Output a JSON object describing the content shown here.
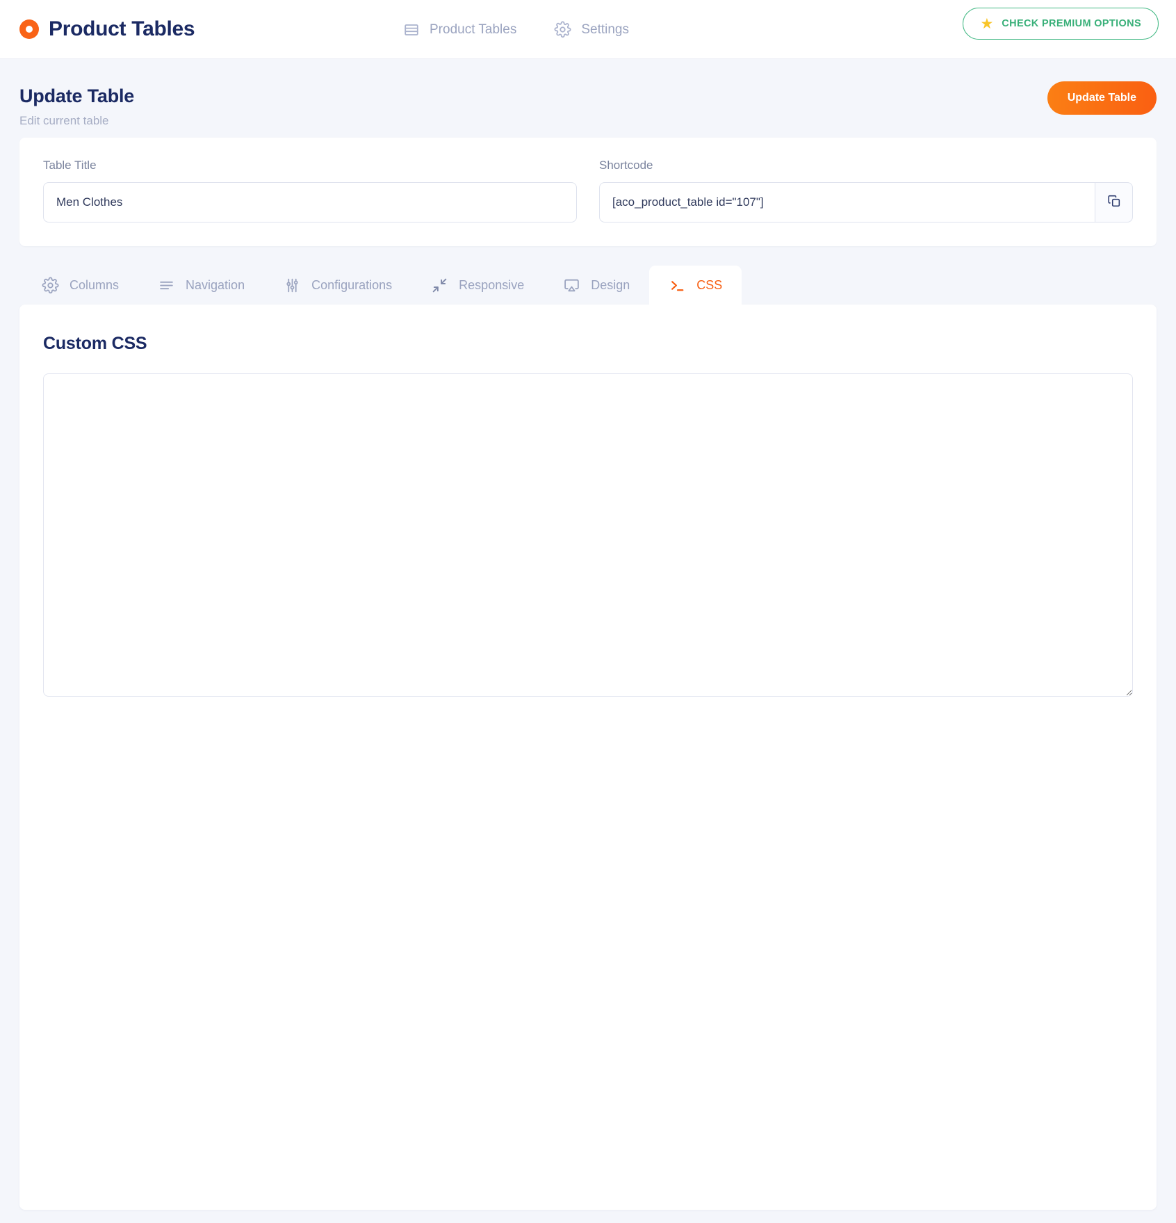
{
  "header": {
    "brand": "Product Tables",
    "logo_icon": "orange-ring-logo",
    "nav": [
      {
        "label": "Product Tables",
        "icon": "table-lines-icon"
      },
      {
        "label": "Settings",
        "icon": "gear-icon"
      }
    ],
    "premium_button": {
      "label": "CHECK PREMIUM OPTIONS",
      "icon": "star-icon",
      "color": "#39b079"
    }
  },
  "page": {
    "title": "Update Table",
    "subtitle": "Edit current table",
    "primary_action": {
      "label": "Update Table",
      "color": "#fa5f12"
    }
  },
  "form": {
    "table_title": {
      "label": "Table Title",
      "value": "Men Clothes",
      "placeholder": "Table Title"
    },
    "shortcode": {
      "label": "Shortcode",
      "value": "[aco_product_table id=\"107\"]",
      "copy_icon": "copy-icon"
    }
  },
  "tabs": [
    {
      "label": "Columns",
      "icon": "gear-icon",
      "active": false
    },
    {
      "label": "Navigation",
      "icon": "menu-lines-icon",
      "active": false
    },
    {
      "label": "Configurations",
      "icon": "sliders-icon",
      "active": false
    },
    {
      "label": "Responsive",
      "icon": "shrink-arrows-icon",
      "active": false
    },
    {
      "label": "Design",
      "icon": "airplay-screen-icon",
      "active": false
    },
    {
      "label": "CSS",
      "icon": "terminal-prompt-icon",
      "active": true
    }
  ],
  "css_panel": {
    "title": "Custom CSS",
    "textarea_value": "",
    "textarea_placeholder": ""
  },
  "colors": {
    "accent_orange": "#fa5f12",
    "brand_navy": "#1b2a63",
    "muted_text": "#9aa3bf",
    "page_bg": "#f4f6fb",
    "premium_green": "#39b079",
    "star_yellow": "#f9c528"
  }
}
